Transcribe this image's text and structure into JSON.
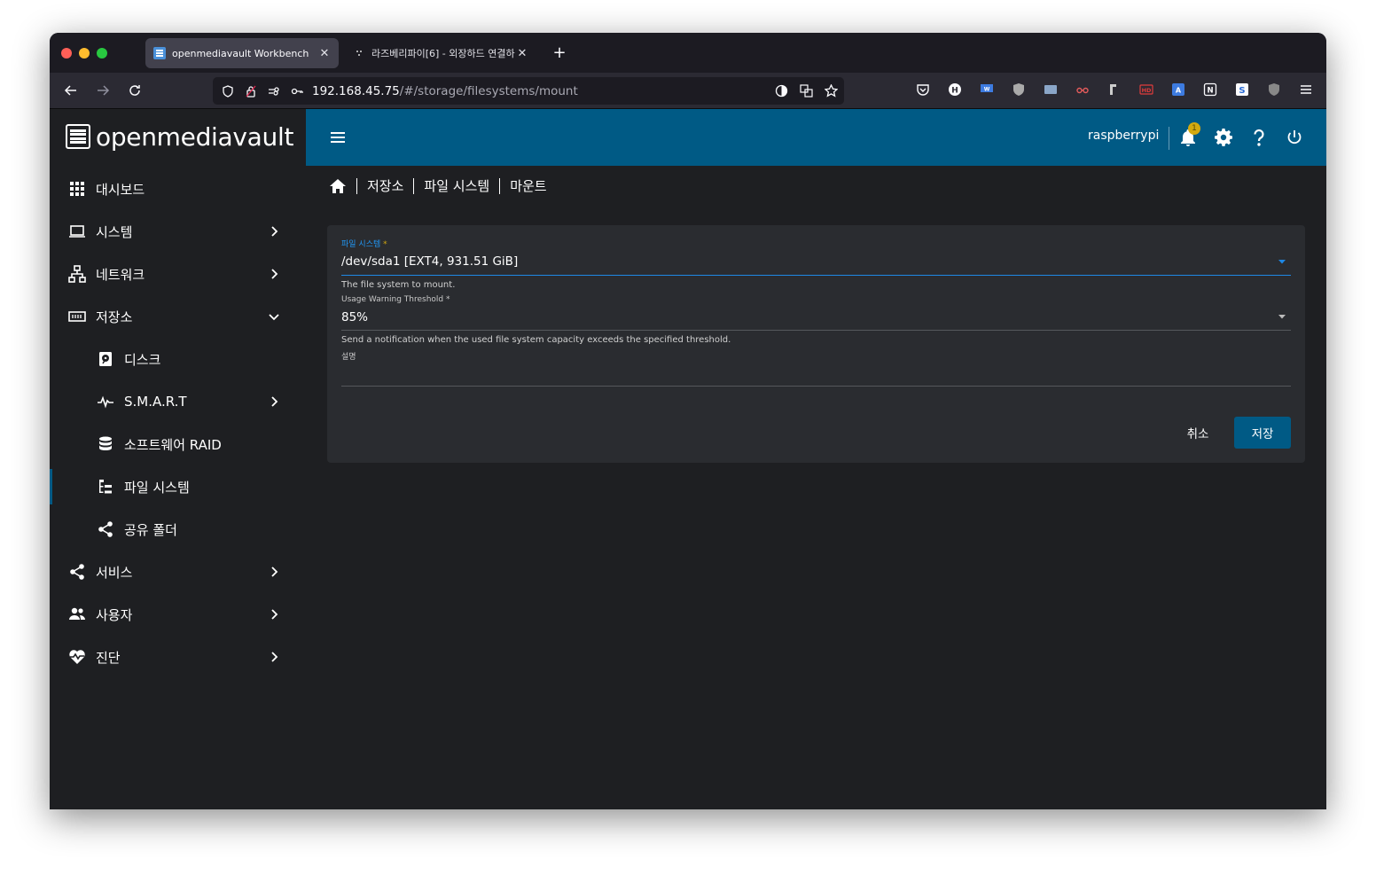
{
  "browser": {
    "tabs": [
      {
        "title": "openmediavault Workbench",
        "close": "✕"
      },
      {
        "title": "라즈베리파이[6] - 외장하드 연결하기",
        "close": "✕"
      }
    ],
    "new_tab": "+",
    "url_host": "192.168.45.75",
    "url_path": "/#/storage/filesystems/mount"
  },
  "app": {
    "brand": "openmediavault",
    "hostname": "raspberrypi",
    "notification_count": "1",
    "accent_color": "#005a85"
  },
  "sidebar": {
    "items": [
      {
        "label": "대시보드"
      },
      {
        "label": "시스템"
      },
      {
        "label": "네트워크"
      },
      {
        "label": "저장소"
      },
      {
        "label": "디스크"
      },
      {
        "label": "S.M.A.R.T"
      },
      {
        "label": "소프트웨어 RAID"
      },
      {
        "label": "파일 시스템"
      },
      {
        "label": "공유 폴더"
      },
      {
        "label": "서비스"
      },
      {
        "label": "사용자"
      },
      {
        "label": "진단"
      }
    ]
  },
  "breadcrumb": [
    "저장소",
    "파일 시스템",
    "마운트"
  ],
  "form": {
    "filesystem": {
      "label": "파일 시스템",
      "required_mark": "*",
      "value": "/dev/sda1 [EXT4, 931.51 GiB]",
      "hint": "The file system to mount."
    },
    "threshold": {
      "label": "Usage Warning Threshold *",
      "value": "85%",
      "hint": "Send a notification when the used file system capacity exceeds the specified threshold."
    },
    "comment": {
      "label": "설명",
      "value": ""
    },
    "cancel_label": "취소",
    "save_label": "저장"
  }
}
